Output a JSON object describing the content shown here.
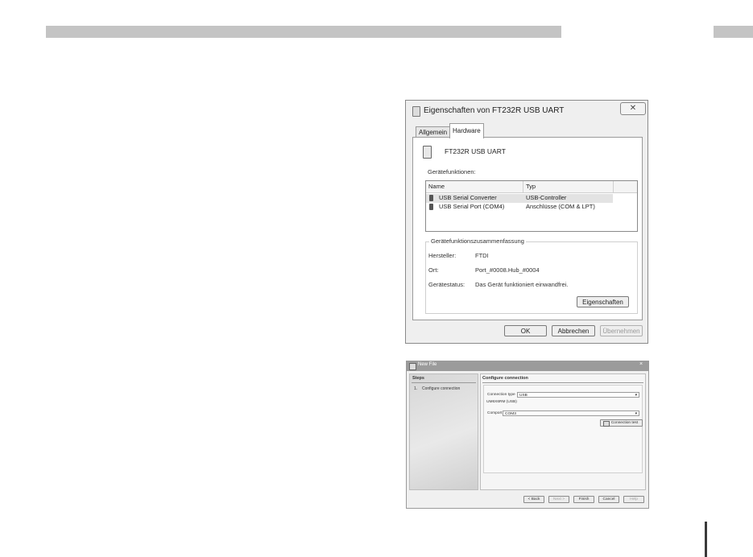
{
  "dialog1": {
    "title": "Eigenschaften von FT232R USB UART",
    "close_symbol": "✕",
    "tabs": [
      {
        "label": "Allgemein",
        "active": false
      },
      {
        "label": "Hardware",
        "active": true
      }
    ],
    "device_name": "FT232R USB UART",
    "functions_label": "Gerätefunktionen:",
    "columns": [
      "Name",
      "Typ"
    ],
    "rows": [
      {
        "name": "USB Serial Converter",
        "type": "USB-Controller",
        "selected": true
      },
      {
        "name": "USB Serial Port (COM4)",
        "type": "Anschlüsse (COM & LPT)",
        "selected": false
      }
    ],
    "summary": {
      "title": "Gerätefunktionszusammenfassung",
      "manufacturer_label": "Hersteller:",
      "manufacturer": "FTDI",
      "location_label": "Ort:",
      "location": "Port_#0008.Hub_#0004",
      "status_label": "Gerätestatus:",
      "status": "Das Gerät funktioniert einwandfrei.",
      "properties_button": "Eigenschaften"
    },
    "buttons": {
      "ok": "OK",
      "cancel": "Abbrechen",
      "apply": "Übernehmen"
    }
  },
  "dialog2": {
    "title": "New File",
    "close_symbol": "×",
    "steps_header": "Steps",
    "steps": [
      {
        "number": "1.",
        "label": "Configure connection"
      }
    ],
    "section_title": "Configure connection",
    "connection_type_label": "Connection type",
    "connection_type_value": "USB",
    "device_id": "UM6X6RM (USB)",
    "comport_label": "Comport",
    "comport_value": "COM3",
    "connection_test_button": "Connection test",
    "buttons": {
      "back": "< Back",
      "next": "Next >",
      "finish": "Finish",
      "cancel": "Cancel",
      "help": "Help"
    }
  },
  "colors": {
    "header_bar": "#c4c4c4",
    "page_marker": "#3a3a3a"
  }
}
